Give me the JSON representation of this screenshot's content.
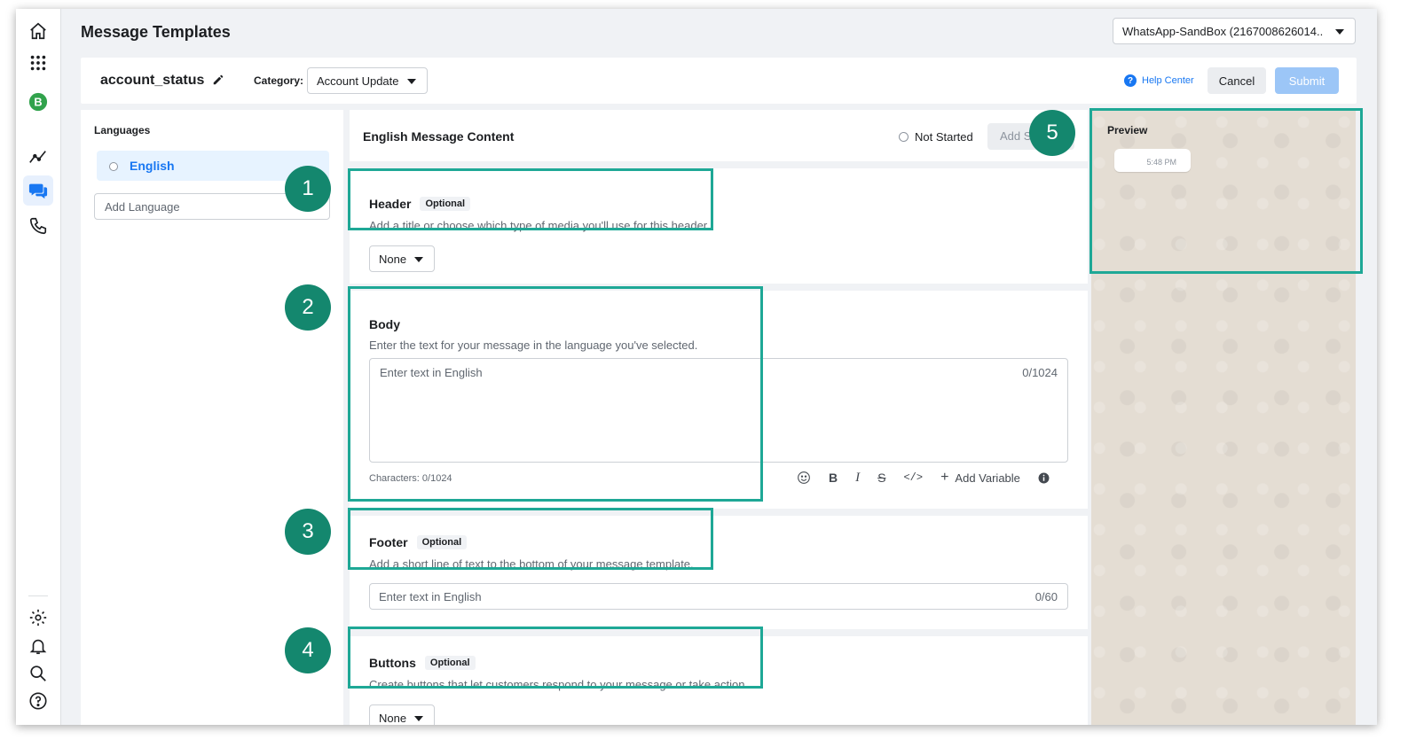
{
  "header": {
    "page_title": "Message Templates",
    "account_selector": "WhatsApp-SandBox (2167008626014.."
  },
  "template": {
    "name": "account_status",
    "category_label": "Category:",
    "category_value": "Account Update",
    "help_center": "Help Center",
    "cancel_label": "Cancel",
    "submit_label": "Submit"
  },
  "languages": {
    "title": "Languages",
    "items": [
      {
        "label": "English"
      }
    ],
    "add_placeholder": "Add Language"
  },
  "content": {
    "title": "English Message Content",
    "status": "Not Started",
    "add_sample_label": "Add Sample",
    "header": {
      "title": "Header",
      "optional": "Optional",
      "description": "Add a title or choose which type of media you'll use for this header.",
      "dropdown_value": "None"
    },
    "body": {
      "title": "Body",
      "description": "Enter the text for your message in the language you've selected.",
      "placeholder": "Enter text in English",
      "counter": "0/1024",
      "characters": "Characters: 0/1024",
      "add_variable": "Add Variable"
    },
    "footer": {
      "title": "Footer",
      "optional": "Optional",
      "description": "Add a short line of text to the bottom of your message template.",
      "placeholder": "Enter text in English",
      "counter": "0/60"
    },
    "buttons": {
      "title": "Buttons",
      "optional": "Optional",
      "description": "Create buttons that let customers respond to your message or take action.",
      "dropdown_value": "None"
    }
  },
  "preview": {
    "title": "Preview",
    "time": "5:48 PM"
  },
  "annotations": {
    "badges": [
      "1",
      "2",
      "3",
      "4",
      "5"
    ],
    "highlight_color": "#1ea896",
    "badge_color": "#14876e"
  },
  "icons": {
    "rail": [
      "home-icon",
      "apps-grid-icon",
      "business-badge-icon",
      "analytics-icon",
      "chat-icon",
      "phone-icon",
      "settings-icon",
      "bell-icon",
      "search-icon",
      "help-icon"
    ]
  }
}
